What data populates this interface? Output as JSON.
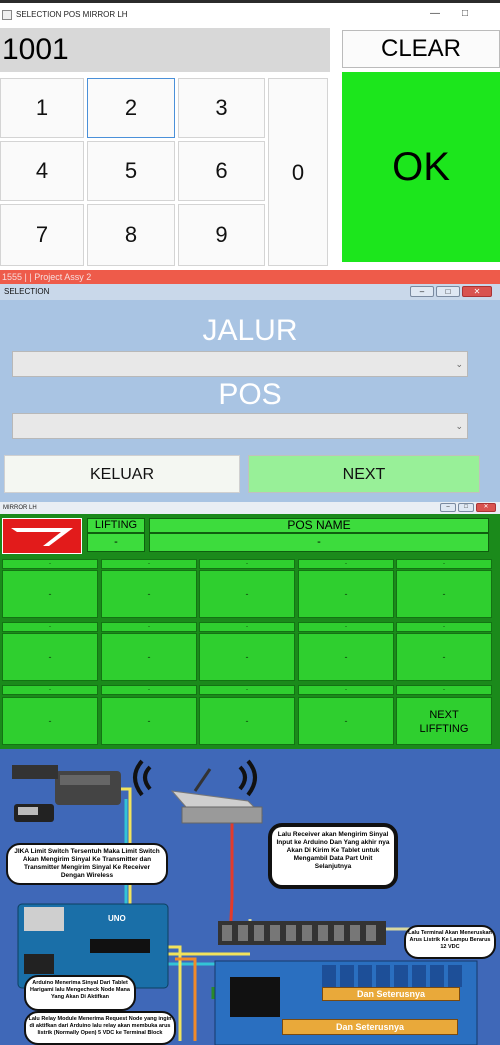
{
  "keypad_window": {
    "title": "SELECTION POS MIRROR LH",
    "display_value": "1001",
    "clear_label": "CLEAR",
    "ok_label": "OK",
    "keys": [
      "1",
      "2",
      "3",
      "4",
      "5",
      "6",
      "7",
      "8",
      "9",
      "0"
    ],
    "ok_color": "#1ce61c"
  },
  "status_strip": {
    "text": "1555 | | Project Assy 2",
    "color": "#ee5b4a"
  },
  "selection_window": {
    "title": "SELECTION",
    "jalur_label": "JALUR",
    "pos_label": "POS",
    "keluar_label": "KELUAR",
    "next_label": "NEXT",
    "background_color": "#a9c4e3"
  },
  "mirror_window": {
    "title": "MIRROR LH",
    "lifting_header": "LIFTING",
    "lifting_value": "-",
    "posname_header": "POS NAME",
    "posname_value": "-",
    "grid_small_label": "-",
    "grid_value": "-",
    "next_lifting_label": "NEXT LIFFTING",
    "brand_icon": "daihatsu-logo-icon"
  },
  "diagram": {
    "bubble_limit_switch": "JIKA Limit Switch Tersentuh Maka Limit Switch Akan Mengirim Sinyal Ke Transmitter dan Transmitter Mengirim Sinyal Ke Receiver Dengan Wireless",
    "bubble_receiver": "Lalu Receiver akan Mengirim Sinyal Input ke Arduino Dan Yang akhir nya Akan Di Kirim Ke Tablet untuk Mengambil Data Part Unit Selanjutnya",
    "bubble_terminal": "Lalu Terminal Akan Meneruskan Arus Listrik Ke Lampu Berarus 12 VDC",
    "bubble_arduino": "Arduino Menerima Sinyal Dari Tablet Harigami lalu Mengecheck Node Mana Yang Akan Di Aktifkan",
    "bubble_relay": "Lalu Relay Module Menerima Request Node yang ingin di aktifkan dari Arduino lalu relay akan membuka arus listrik (Normally Open) 5 VDC ke Terminal Block",
    "board_label": "UNO",
    "arrow_top": "Dan Seterusnya",
    "arrow_bottom": "Dan Seterusnya"
  }
}
